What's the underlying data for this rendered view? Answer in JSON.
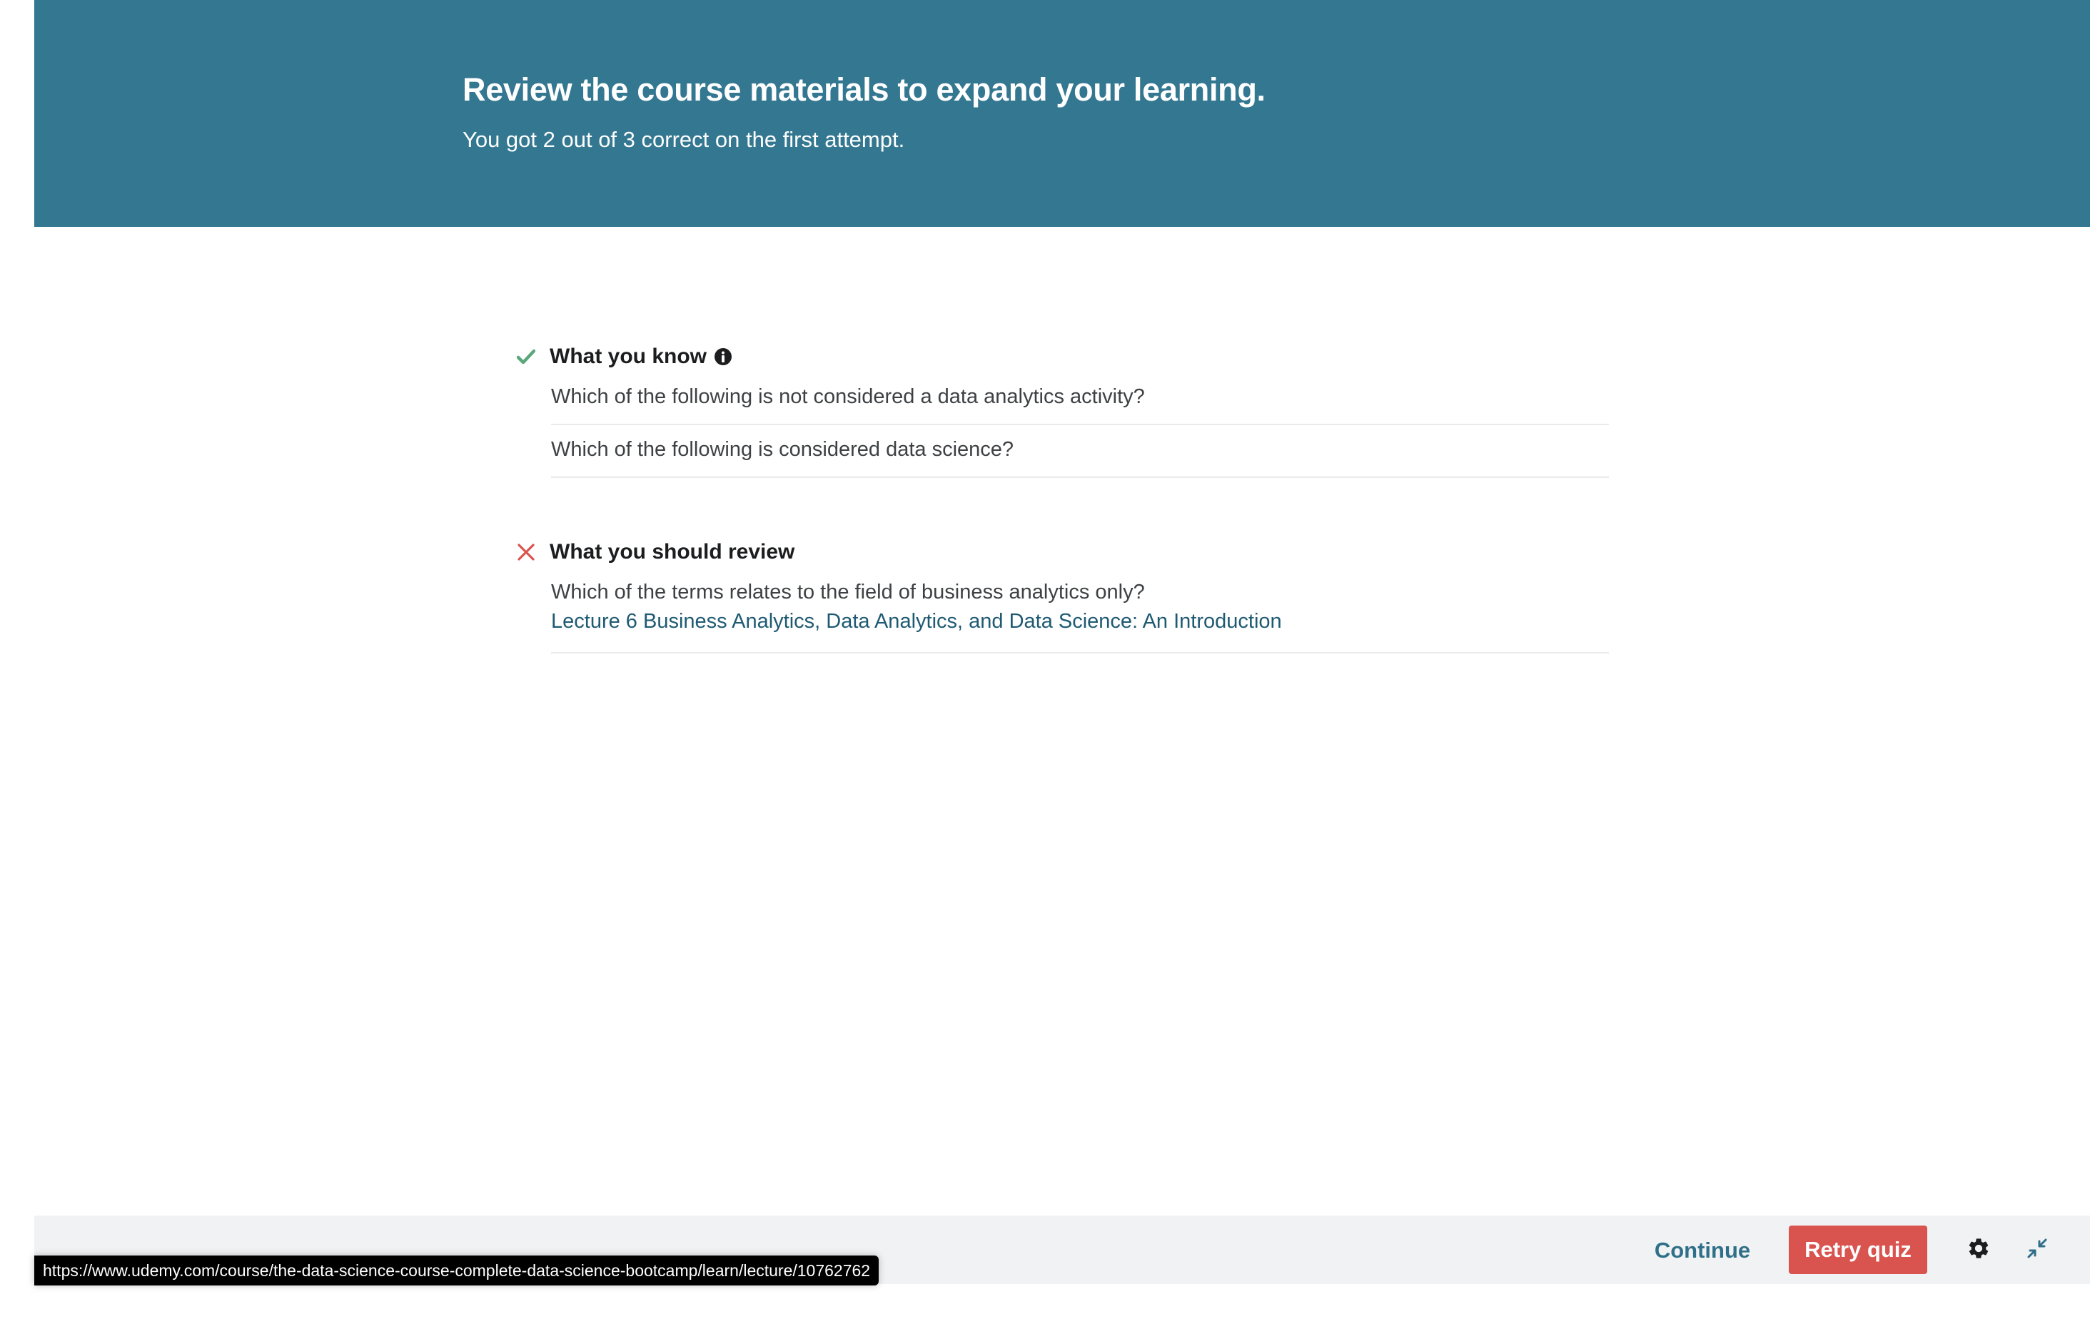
{
  "header": {
    "title": "Review the course materials to expand your learning.",
    "subtitle": "You got 2 out of 3 correct on the first attempt."
  },
  "known": {
    "title": "What you know",
    "items": [
      "Which of the following is not considered a data analytics activity?",
      "Which of the following is considered data science?"
    ]
  },
  "review": {
    "title": "What you should review",
    "items": [
      {
        "question": "Which of the terms relates to the field of business analytics only?",
        "lecture_link": "Lecture 6 Business Analytics, Data Analytics, and Data Science: An Introduction"
      }
    ]
  },
  "footer": {
    "continue_label": "Continue",
    "retry_label": "Retry quiz"
  },
  "status_url": "https://www.udemy.com/course/the-data-science-course-complete-data-science-bootcamp/learn/lecture/10762762",
  "colors": {
    "header_bg": "#337791",
    "success": "#5aa77b",
    "error": "#d9534f",
    "link": "#1e5a72"
  },
  "icons": [
    "check-icon",
    "info-icon",
    "cross-icon",
    "gear-icon",
    "collapse-icon"
  ]
}
